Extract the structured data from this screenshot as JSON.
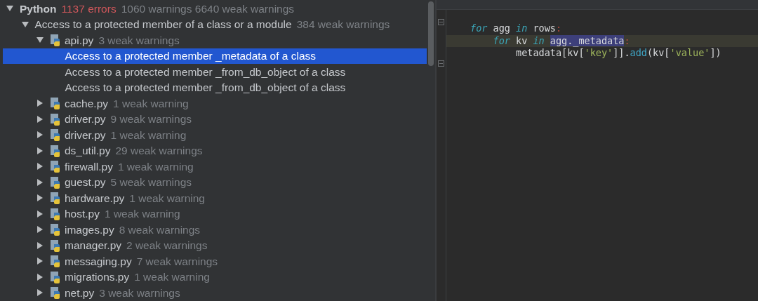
{
  "tree": [
    {
      "label": "Python",
      "kind": "group",
      "expanded": true,
      "selected": false,
      "notes": [
        {
          "text": "1137 errors",
          "kind": "error"
        },
        {
          "text": "1060 warnings 6640 weak warnings",
          "kind": "info"
        }
      ],
      "children": [
        {
          "label": "Access to a protected member of a class or a module",
          "kind": "inspection",
          "expanded": true,
          "selected": false,
          "notes": [
            {
              "text": "384 weak warnings",
              "kind": "info"
            }
          ],
          "children": [
            {
              "label": "api.py",
              "kind": "python-file",
              "expanded": true,
              "selected": false,
              "notes": [
                {
                  "text": "3 weak warnings",
                  "kind": "info"
                }
              ],
              "children": [
                {
                  "label": "Access to a protected member _metadata of a class",
                  "kind": "problem",
                  "selected": true
                },
                {
                  "label": "Access to a protected member _from_db_object of a class",
                  "kind": "problem",
                  "selected": false
                },
                {
                  "label": "Access to a protected member _from_db_object of a class",
                  "kind": "problem",
                  "selected": false
                }
              ]
            },
            {
              "label": "cache.py",
              "kind": "python-file",
              "expanded": false,
              "selected": false,
              "notes": [
                {
                  "text": "1 weak warning",
                  "kind": "info"
                }
              ]
            },
            {
              "label": "driver.py",
              "kind": "python-file",
              "expanded": false,
              "selected": false,
              "notes": [
                {
                  "text": "9 weak warnings",
                  "kind": "info"
                }
              ]
            },
            {
              "label": "driver.py",
              "kind": "python-file",
              "expanded": false,
              "selected": false,
              "notes": [
                {
                  "text": "1 weak warning",
                  "kind": "info"
                }
              ]
            },
            {
              "label": "ds_util.py",
              "kind": "python-file",
              "expanded": false,
              "selected": false,
              "notes": [
                {
                  "text": "29 weak warnings",
                  "kind": "info"
                }
              ]
            },
            {
              "label": "firewall.py",
              "kind": "python-file",
              "expanded": false,
              "selected": false,
              "notes": [
                {
                  "text": "1 weak warning",
                  "kind": "info"
                }
              ]
            },
            {
              "label": "guest.py",
              "kind": "python-file",
              "expanded": false,
              "selected": false,
              "notes": [
                {
                  "text": "5 weak warnings",
                  "kind": "info"
                }
              ]
            },
            {
              "label": "hardware.py",
              "kind": "python-file",
              "expanded": false,
              "selected": false,
              "notes": [
                {
                  "text": "1 weak warning",
                  "kind": "info"
                }
              ]
            },
            {
              "label": "host.py",
              "kind": "python-file",
              "expanded": false,
              "selected": false,
              "notes": [
                {
                  "text": "1 weak warning",
                  "kind": "info"
                }
              ]
            },
            {
              "label": "images.py",
              "kind": "python-file",
              "expanded": false,
              "selected": false,
              "notes": [
                {
                  "text": "8 weak warnings",
                  "kind": "info"
                }
              ]
            },
            {
              "label": "manager.py",
              "kind": "python-file",
              "expanded": false,
              "selected": false,
              "notes": [
                {
                  "text": "2 weak warnings",
                  "kind": "info"
                }
              ]
            },
            {
              "label": "messaging.py",
              "kind": "python-file",
              "expanded": false,
              "selected": false,
              "notes": [
                {
                  "text": "7 weak warnings",
                  "kind": "info"
                }
              ]
            },
            {
              "label": "migrations.py",
              "kind": "python-file",
              "expanded": false,
              "selected": false,
              "notes": [
                {
                  "text": "1 weak warning",
                  "kind": "info"
                }
              ]
            },
            {
              "label": "net.py",
              "kind": "python-file",
              "expanded": false,
              "selected": false,
              "notes": [
                {
                  "text": "3 weak warnings",
                  "kind": "info"
                }
              ]
            }
          ]
        }
      ]
    }
  ],
  "editor": {
    "lines": [
      {
        "current": false,
        "tokens": [
          {
            "text": "for",
            "kind": "keyword"
          },
          {
            "text": " agg ",
            "kind": "plain"
          },
          {
            "text": "in",
            "kind": "keyword"
          },
          {
            "text": " rows",
            "kind": "plain"
          },
          {
            "text": ":",
            "kind": "punct"
          }
        ]
      },
      {
        "current": true,
        "tokens": [
          {
            "text": "    for",
            "kind": "keyword"
          },
          {
            "text": " kv ",
            "kind": "plain"
          },
          {
            "text": "in ",
            "kind": "keyword"
          },
          {
            "text": "agg._metadata",
            "kind": "highlight"
          },
          {
            "text": ":",
            "kind": "punct"
          }
        ]
      },
      {
        "current": false,
        "tokens": [
          {
            "text": "        metadata[kv[",
            "kind": "plain"
          },
          {
            "text": "'key'",
            "kind": "string"
          },
          {
            "text": "]].",
            "kind": "plain"
          },
          {
            "text": "add",
            "kind": "func"
          },
          {
            "text": "(kv[",
            "kind": "plain"
          },
          {
            "text": "'value'",
            "kind": "string"
          },
          {
            "text": "])",
            "kind": "plain"
          }
        ]
      }
    ]
  }
}
